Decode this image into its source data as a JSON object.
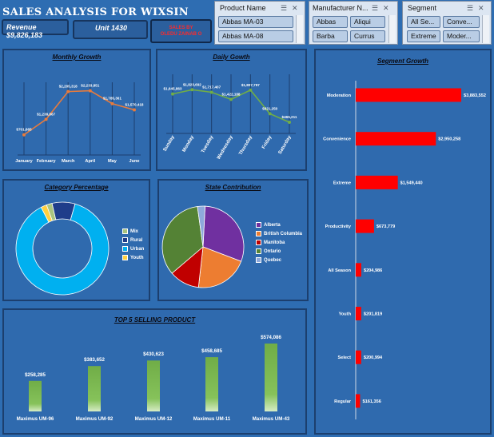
{
  "title": "SALES ANALYSIS FOR WIXSIN",
  "kpis": {
    "revenue": "Revenue $9,826,183",
    "unit": "Unit 1430",
    "sales_by_line1": "SALES BY",
    "sales_by_line2": "OLEDU ZAINAB O"
  },
  "slicers": {
    "product": {
      "label": "Product Name",
      "items": [
        "Abbas MA-03",
        "Abbas MA-08"
      ]
    },
    "manufacturer": {
      "label": "Manufacturer N...",
      "items": [
        "Abbas",
        "Aliqui",
        "Barba",
        "Currus"
      ]
    },
    "segment": {
      "label": "Segment",
      "items": [
        "All Se...",
        "Conve...",
        "Extreme",
        "Moder..."
      ]
    }
  },
  "colors": {
    "accent": "#e87b3c",
    "green": "#70ad47",
    "red": "#ff0000",
    "pie_cyan": "#00b0f0",
    "navy": "#1f3d8a"
  },
  "chart_data": [
    {
      "type": "line",
      "title": "Monthly Growth",
      "categories": [
        "January",
        "February",
        "March",
        "April",
        "May",
        "June"
      ],
      "values": [
        701665,
        1238867,
        2205318,
        2233851,
        1785361,
        1570418
      ],
      "labels": [
        "$701,665",
        "$1,238,867",
        "$2,205,318",
        "$2,233,851",
        "$1,785,361",
        "$1,570,418"
      ],
      "ylim": [
        0,
        2500000
      ]
    },
    {
      "type": "line",
      "title": "Daily Gowth",
      "categories": [
        "Sunday",
        "Monday",
        "Tuesday",
        "Wednesday",
        "Thursday",
        "Friday",
        "Saturday"
      ],
      "values": [
        1645863,
        1823692,
        1717407,
        1422188,
        1807797,
        821250,
        465211
      ],
      "labels": [
        "$1,645,863",
        "$1,823,692",
        "$1,717,407",
        "$1,422,188",
        "$1,807,797",
        "$821,250",
        "$465,211"
      ],
      "ylim": [
        0,
        2000000
      ]
    },
    {
      "type": "bar",
      "title": "Segment Growth",
      "categories": [
        "Moderation",
        "Convenience",
        "Extreme",
        "Productivity",
        "All Season",
        "Youth",
        "Select",
        "Regular"
      ],
      "values": [
        3883552,
        2950258,
        1549440,
        673779,
        204986,
        201819,
        200994,
        161356
      ],
      "labels": [
        "$3,883,552",
        "$2,950,258",
        "$1,549,440",
        "$673,779",
        "$204,986",
        "$201,819",
        "$200,994",
        "$161,356"
      ]
    },
    {
      "type": "pie",
      "title": "Category Percentage",
      "categories": [
        "Mix",
        "Rural",
        "Urban",
        "Youth"
      ],
      "values": [
        2,
        8,
        88,
        2
      ],
      "colors": [
        "#a9c47f",
        "#1f3d8a",
        "#00b0f0",
        "#ffd040"
      ]
    },
    {
      "type": "pie",
      "title": "State Contribution",
      "categories": [
        "Alberta",
        "British Columbia",
        "Manitoba",
        "Ontario",
        "Quebec"
      ],
      "values": [
        30,
        21,
        12,
        34,
        3
      ],
      "colors": [
        "#7030a0",
        "#ed7d31",
        "#c00000",
        "#548235",
        "#8ea9db"
      ]
    },
    {
      "type": "bar",
      "title": "TOP 5 SELLING PRODUCT",
      "categories": [
        "Maximus UM-96",
        "Maximus UM-92",
        "Maximus UM-12",
        "Maximus UM-11",
        "Maximus UM-43"
      ],
      "values": [
        258285,
        383652,
        430623,
        458685,
        574086
      ],
      "labels": [
        "$258,285",
        "$383,652",
        "$430,623",
        "$458,685",
        "$574,086"
      ]
    }
  ]
}
